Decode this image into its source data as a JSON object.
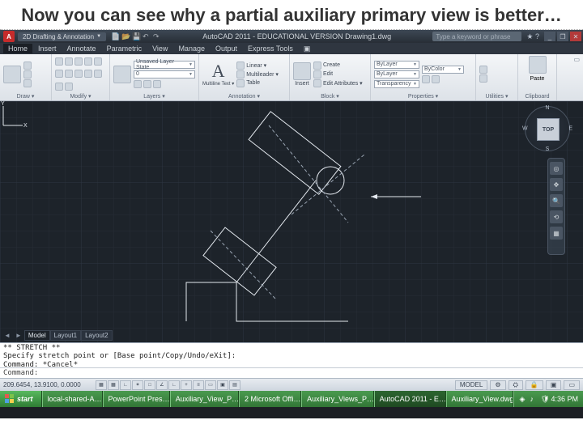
{
  "slide": {
    "title": "Now you can see why a partial auxiliary primary view is better…"
  },
  "titlebar": {
    "workspace": "2D Drafting & Annotation",
    "title": "AutoCAD 2011 - EDUCATIONAL VERSION   Drawing1.dwg",
    "search_placeholder": "Type a keyword or phrase",
    "min": "_",
    "max": "❐",
    "close": "✕"
  },
  "menu": {
    "items": [
      "Home",
      "Insert",
      "Annotate",
      "Parametric",
      "View",
      "Manage",
      "Output",
      "Express Tools"
    ],
    "extra": "▣"
  },
  "ribbon": {
    "panels": [
      {
        "name": "Draw",
        "title": "Draw ▾"
      },
      {
        "name": "Modify",
        "title": "Modify ▾"
      },
      {
        "name": "Layers",
        "title": "Layers ▾",
        "combo1": "Unsaved Layer State",
        "combo2": "0"
      },
      {
        "name": "Annotation",
        "title": "Annotation ▾",
        "rows": [
          "Linear ▾",
          "Multileader ▾",
          "Table"
        ],
        "big": "A",
        "sub": "Multiline Text ▾"
      },
      {
        "name": "Block",
        "title": "Block ▾",
        "rows": [
          "Create",
          "Edit",
          "Edit Attributes ▾"
        ],
        "big_label": "Insert"
      },
      {
        "name": "Properties",
        "title": "Properties ▾",
        "combo1": "ByLayer",
        "combo2": "ByLayer",
        "combo3": "Transparency",
        "combo4": "ByColor"
      },
      {
        "name": "Utilities",
        "title": "Utilities ▾"
      },
      {
        "name": "Clipboard",
        "title": "Clipboard",
        "big_label": "Paste"
      }
    ]
  },
  "viewcube": {
    "face": "TOP",
    "n": "N",
    "s": "S",
    "e": "E",
    "w": "W"
  },
  "tabs": {
    "items": [
      "Model",
      "Layout1",
      "Layout2"
    ],
    "prev": "◄",
    "next": "►"
  },
  "command": {
    "lines": [
      "** STRETCH **",
      "Specify stretch point or [Base point/Copy/Undo/eXit]:",
      "Command: *Cancel*"
    ],
    "prompt": "Command:"
  },
  "status": {
    "coords": "209.6454, 13.9100, 0.0000",
    "right_label": "MODEL"
  },
  "taskbar": {
    "start": "start",
    "tasks": [
      "local-shared-A…",
      "PowerPoint Pres…",
      "Auxiliary_View_P…",
      "2 Microsoft Offi…",
      "Auxiliary_Views_P…",
      "AutoCAD 2011 - E…",
      "Auxiliary_View.dwg"
    ],
    "clock": "4:36 PM"
  },
  "colors": {
    "canvas_bg": "#1d232a",
    "drawing": "#e4e9ef",
    "accent_green": "#3a8c3f"
  }
}
